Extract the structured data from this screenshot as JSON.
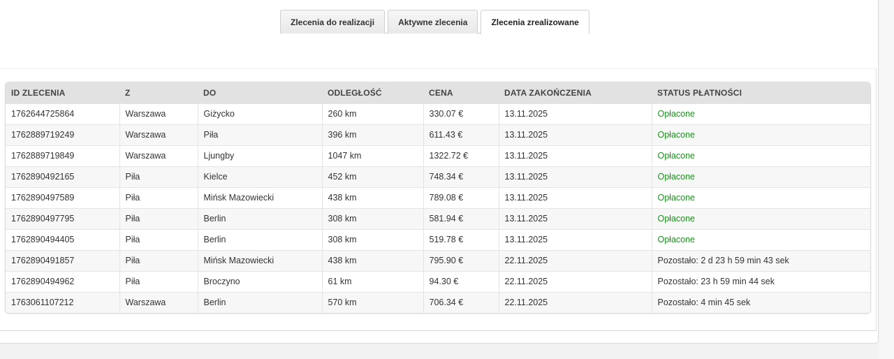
{
  "tabs": [
    {
      "label": "Zlecenia do realizacji",
      "active": false
    },
    {
      "label": "Aktywne zlecenia",
      "active": false
    },
    {
      "label": "Zlecenia zrealizowane",
      "active": true
    }
  ],
  "table": {
    "columns": [
      "ID ZLECENIA",
      "Z",
      "DO",
      "ODLEGŁOŚĆ",
      "CENA",
      "DATA ZAKOŃCZENIA",
      "STATUS PŁATNOŚCI"
    ],
    "rows": [
      {
        "id": "1762644725864",
        "from": "Warszawa",
        "to": "Giżycko",
        "distance": "260 km",
        "price": "330.07 €",
        "date": "13.11.2025",
        "status": "Opłacone",
        "paid": true
      },
      {
        "id": "1762889719249",
        "from": "Warszawa",
        "to": "Piła",
        "distance": "396 km",
        "price": "611.43 €",
        "date": "13.11.2025",
        "status": "Opłacone",
        "paid": true
      },
      {
        "id": "1762889719849",
        "from": "Warszawa",
        "to": "Ljungby",
        "distance": "1047 km",
        "price": "1322.72 €",
        "date": "13.11.2025",
        "status": "Opłacone",
        "paid": true
      },
      {
        "id": "1762890492165",
        "from": "Piła",
        "to": "Kielce",
        "distance": "452 km",
        "price": "748.34 €",
        "date": "13.11.2025",
        "status": "Opłacone",
        "paid": true
      },
      {
        "id": "1762890497589",
        "from": "Piła",
        "to": "Mińsk Mazowiecki",
        "distance": "438 km",
        "price": "789.08 €",
        "date": "13.11.2025",
        "status": "Opłacone",
        "paid": true
      },
      {
        "id": "1762890497795",
        "from": "Piła",
        "to": "Berlin",
        "distance": "308 km",
        "price": "581.94 €",
        "date": "13.11.2025",
        "status": "Opłacone",
        "paid": true
      },
      {
        "id": "1762890494405",
        "from": "Piła",
        "to": "Berlin",
        "distance": "308 km",
        "price": "519.78 €",
        "date": "13.11.2025",
        "status": "Opłacone",
        "paid": true
      },
      {
        "id": "1762890491857",
        "from": "Piła",
        "to": "Mińsk Mazowiecki",
        "distance": "438 km",
        "price": "795.90 €",
        "date": "22.11.2025",
        "status": "Pozostało: 2 d 23 h 59 min 43 sek",
        "paid": false
      },
      {
        "id": "1762890494962",
        "from": "Piła",
        "to": "Broczyno",
        "distance": "61 km",
        "price": "94.30 €",
        "date": "22.11.2025",
        "status": "Pozostało: 23 h 59 min 44 sek",
        "paid": false
      },
      {
        "id": "1763061107212",
        "from": "Warszawa",
        "to": "Berlin",
        "distance": "570 km",
        "price": "706.34 €",
        "date": "22.11.2025",
        "status": "Pozostało: 4 min 45 sek",
        "paid": false
      }
    ]
  },
  "colors": {
    "paid": "#1f8f1f",
    "header_bg": "#e2e2e2"
  }
}
